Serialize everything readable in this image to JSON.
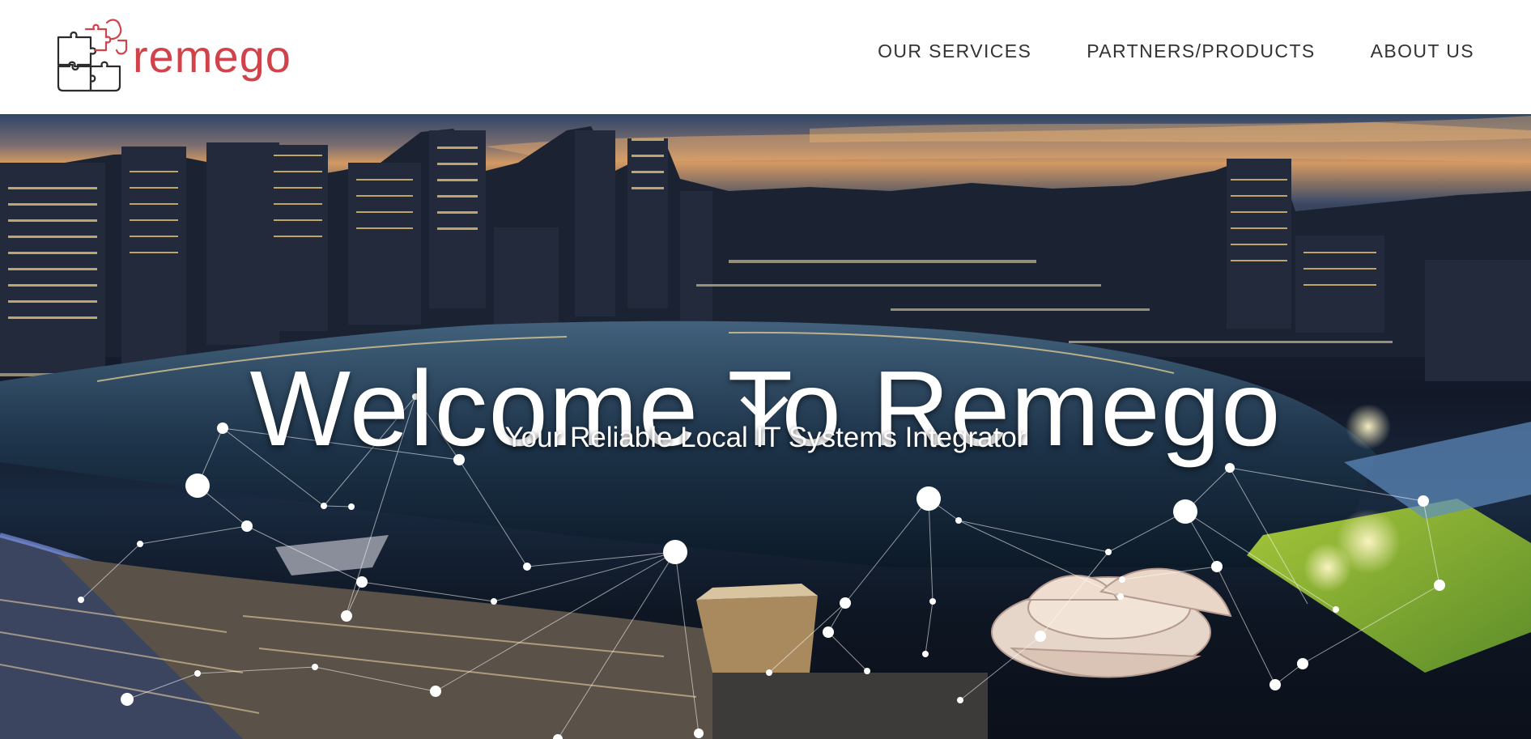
{
  "brand": {
    "logo_text": "remego",
    "logo_icon": "puzzle-icon",
    "color": "#d0434a"
  },
  "nav": {
    "items": [
      {
        "label": "OUR SERVICES"
      },
      {
        "label": "PARTNERS/PRODUCTS"
      },
      {
        "label": "ABOUT US"
      }
    ]
  },
  "hero": {
    "title": "Welcome To Remego",
    "subtitle": "Your Reliable Local IT Systems Integrator",
    "scroll_icon": "chevron-down-icon",
    "background": "night-city-skyline-with-network-overlay"
  }
}
